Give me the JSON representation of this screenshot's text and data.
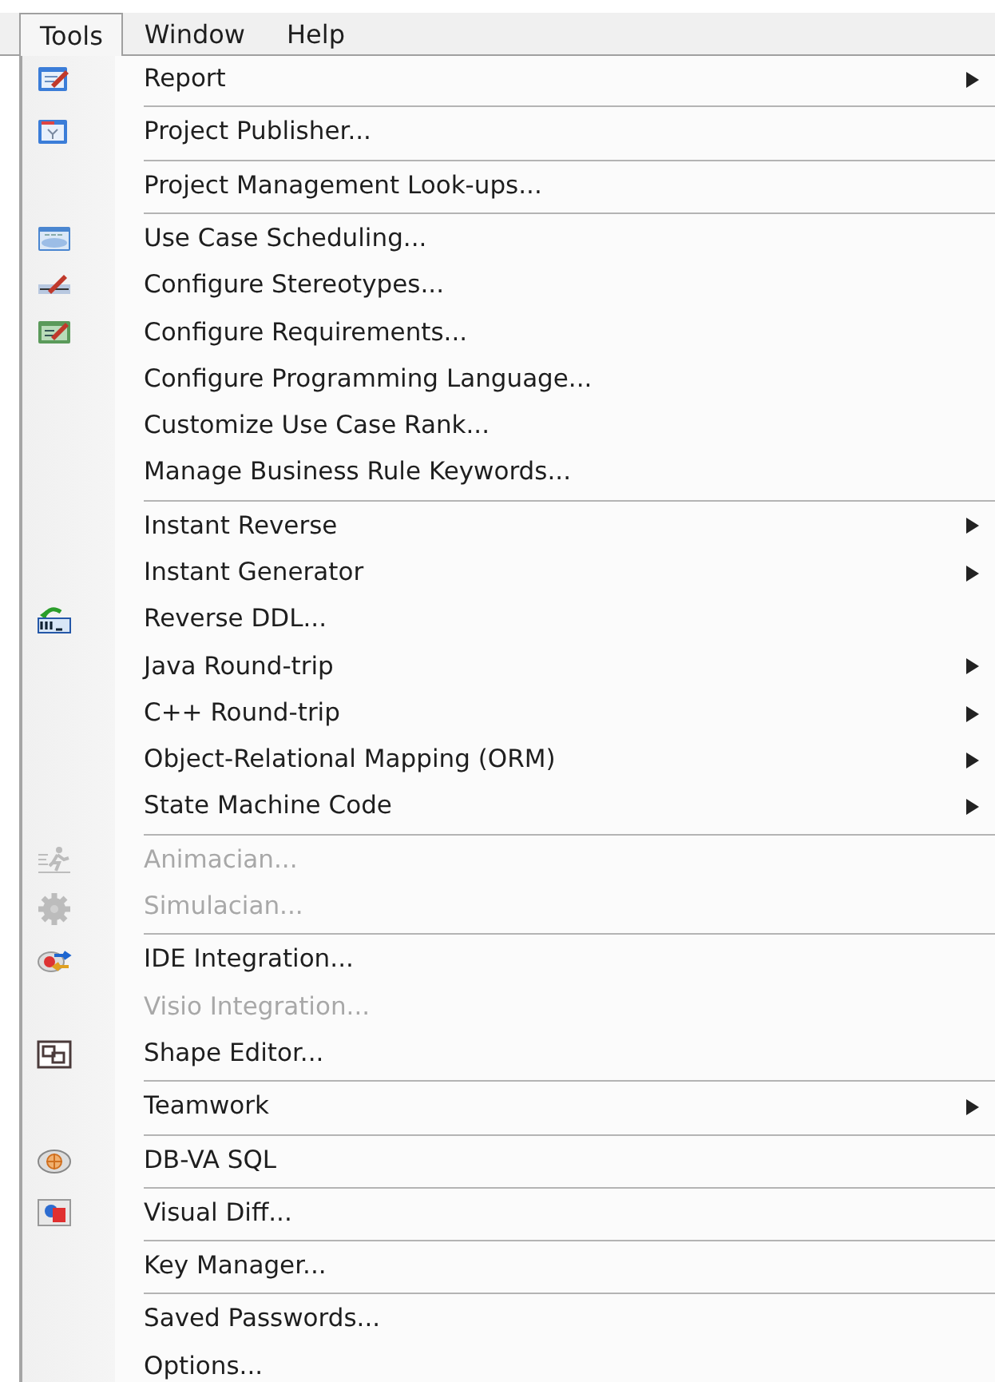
{
  "menubar": [
    {
      "label": "Tools",
      "selected": true
    },
    {
      "label": "Window",
      "selected": false
    },
    {
      "label": "Help",
      "selected": false
    }
  ],
  "menu": {
    "items": [
      {
        "label": "Report",
        "icon": true,
        "submenu": true,
        "disabled": false,
        "separator_before": false
      },
      {
        "label": "Project Publisher...",
        "icon": true,
        "submenu": false,
        "disabled": false,
        "separator_before": true
      },
      {
        "label": "Project Management Look-ups...",
        "icon": false,
        "submenu": false,
        "disabled": false,
        "separator_before": true
      },
      {
        "label": "Use Case Scheduling...",
        "icon": true,
        "submenu": false,
        "disabled": false,
        "separator_before": true
      },
      {
        "label": "Configure Stereotypes...",
        "icon": true,
        "submenu": false,
        "disabled": false,
        "separator_before": false
      },
      {
        "label": "Configure Requirements...",
        "icon": true,
        "submenu": false,
        "disabled": false,
        "separator_before": false
      },
      {
        "label": "Configure Programming Language...",
        "icon": false,
        "submenu": false,
        "disabled": false,
        "separator_before": false
      },
      {
        "label": "Customize Use Case Rank...",
        "icon": false,
        "submenu": false,
        "disabled": false,
        "separator_before": false
      },
      {
        "label": "Manage Business Rule Keywords...",
        "icon": false,
        "submenu": false,
        "disabled": false,
        "separator_before": false
      },
      {
        "label": "Instant Reverse",
        "icon": false,
        "submenu": true,
        "disabled": false,
        "separator_before": true
      },
      {
        "label": "Instant Generator",
        "icon": false,
        "submenu": true,
        "disabled": false,
        "separator_before": false
      },
      {
        "label": "Reverse DDL...",
        "icon": true,
        "submenu": false,
        "disabled": false,
        "separator_before": false
      },
      {
        "label": "Java Round-trip",
        "icon": false,
        "submenu": true,
        "disabled": false,
        "separator_before": false
      },
      {
        "label": "C++ Round-trip",
        "icon": false,
        "submenu": true,
        "disabled": false,
        "separator_before": false
      },
      {
        "label": "Object-Relational Mapping (ORM)",
        "icon": false,
        "submenu": true,
        "disabled": false,
        "separator_before": false
      },
      {
        "label": "State Machine Code",
        "icon": false,
        "submenu": true,
        "disabled": false,
        "separator_before": false
      },
      {
        "label": "Animacian...",
        "icon": true,
        "submenu": false,
        "disabled": true,
        "separator_before": true
      },
      {
        "label": "Simulacian...",
        "icon": true,
        "submenu": false,
        "disabled": true,
        "separator_before": false
      },
      {
        "label": "IDE Integration...",
        "icon": true,
        "submenu": false,
        "disabled": false,
        "separator_before": true
      },
      {
        "label": "Visio Integration...",
        "icon": false,
        "submenu": false,
        "disabled": true,
        "separator_before": false
      },
      {
        "label": "Shape Editor...",
        "icon": true,
        "submenu": false,
        "disabled": false,
        "separator_before": false
      },
      {
        "label": "Teamwork",
        "icon": false,
        "submenu": true,
        "disabled": false,
        "separator_before": true
      },
      {
        "label": "DB-VA SQL",
        "icon": true,
        "submenu": false,
        "disabled": false,
        "separator_before": true
      },
      {
        "label": "Visual Diff...",
        "icon": true,
        "submenu": false,
        "disabled": false,
        "separator_before": true
      },
      {
        "label": "Key Manager...",
        "icon": false,
        "submenu": false,
        "disabled": false,
        "separator_before": true
      },
      {
        "label": "Saved Passwords...",
        "icon": false,
        "submenu": false,
        "disabled": false,
        "separator_before": true
      },
      {
        "label": "Options...",
        "icon": false,
        "submenu": false,
        "disabled": false,
        "separator_before": false
      }
    ]
  }
}
